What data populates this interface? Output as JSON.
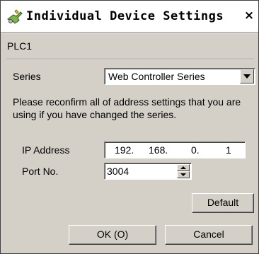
{
  "window": {
    "title": "Individual Device Settings",
    "close_label": "×"
  },
  "device": {
    "name": "PLC1"
  },
  "series": {
    "label": "Series",
    "selected": "Web Controller Series"
  },
  "note": "Please reconfirm all of address settings that you are using if you have changed the series.",
  "ip_address": {
    "label": "IP Address",
    "octets": [
      "192.",
      "168.",
      "0.",
      "1"
    ]
  },
  "port": {
    "label": "Port No.",
    "value": "3004"
  },
  "buttons": {
    "default": "Default",
    "ok": "OK (O)",
    "cancel": "Cancel"
  }
}
